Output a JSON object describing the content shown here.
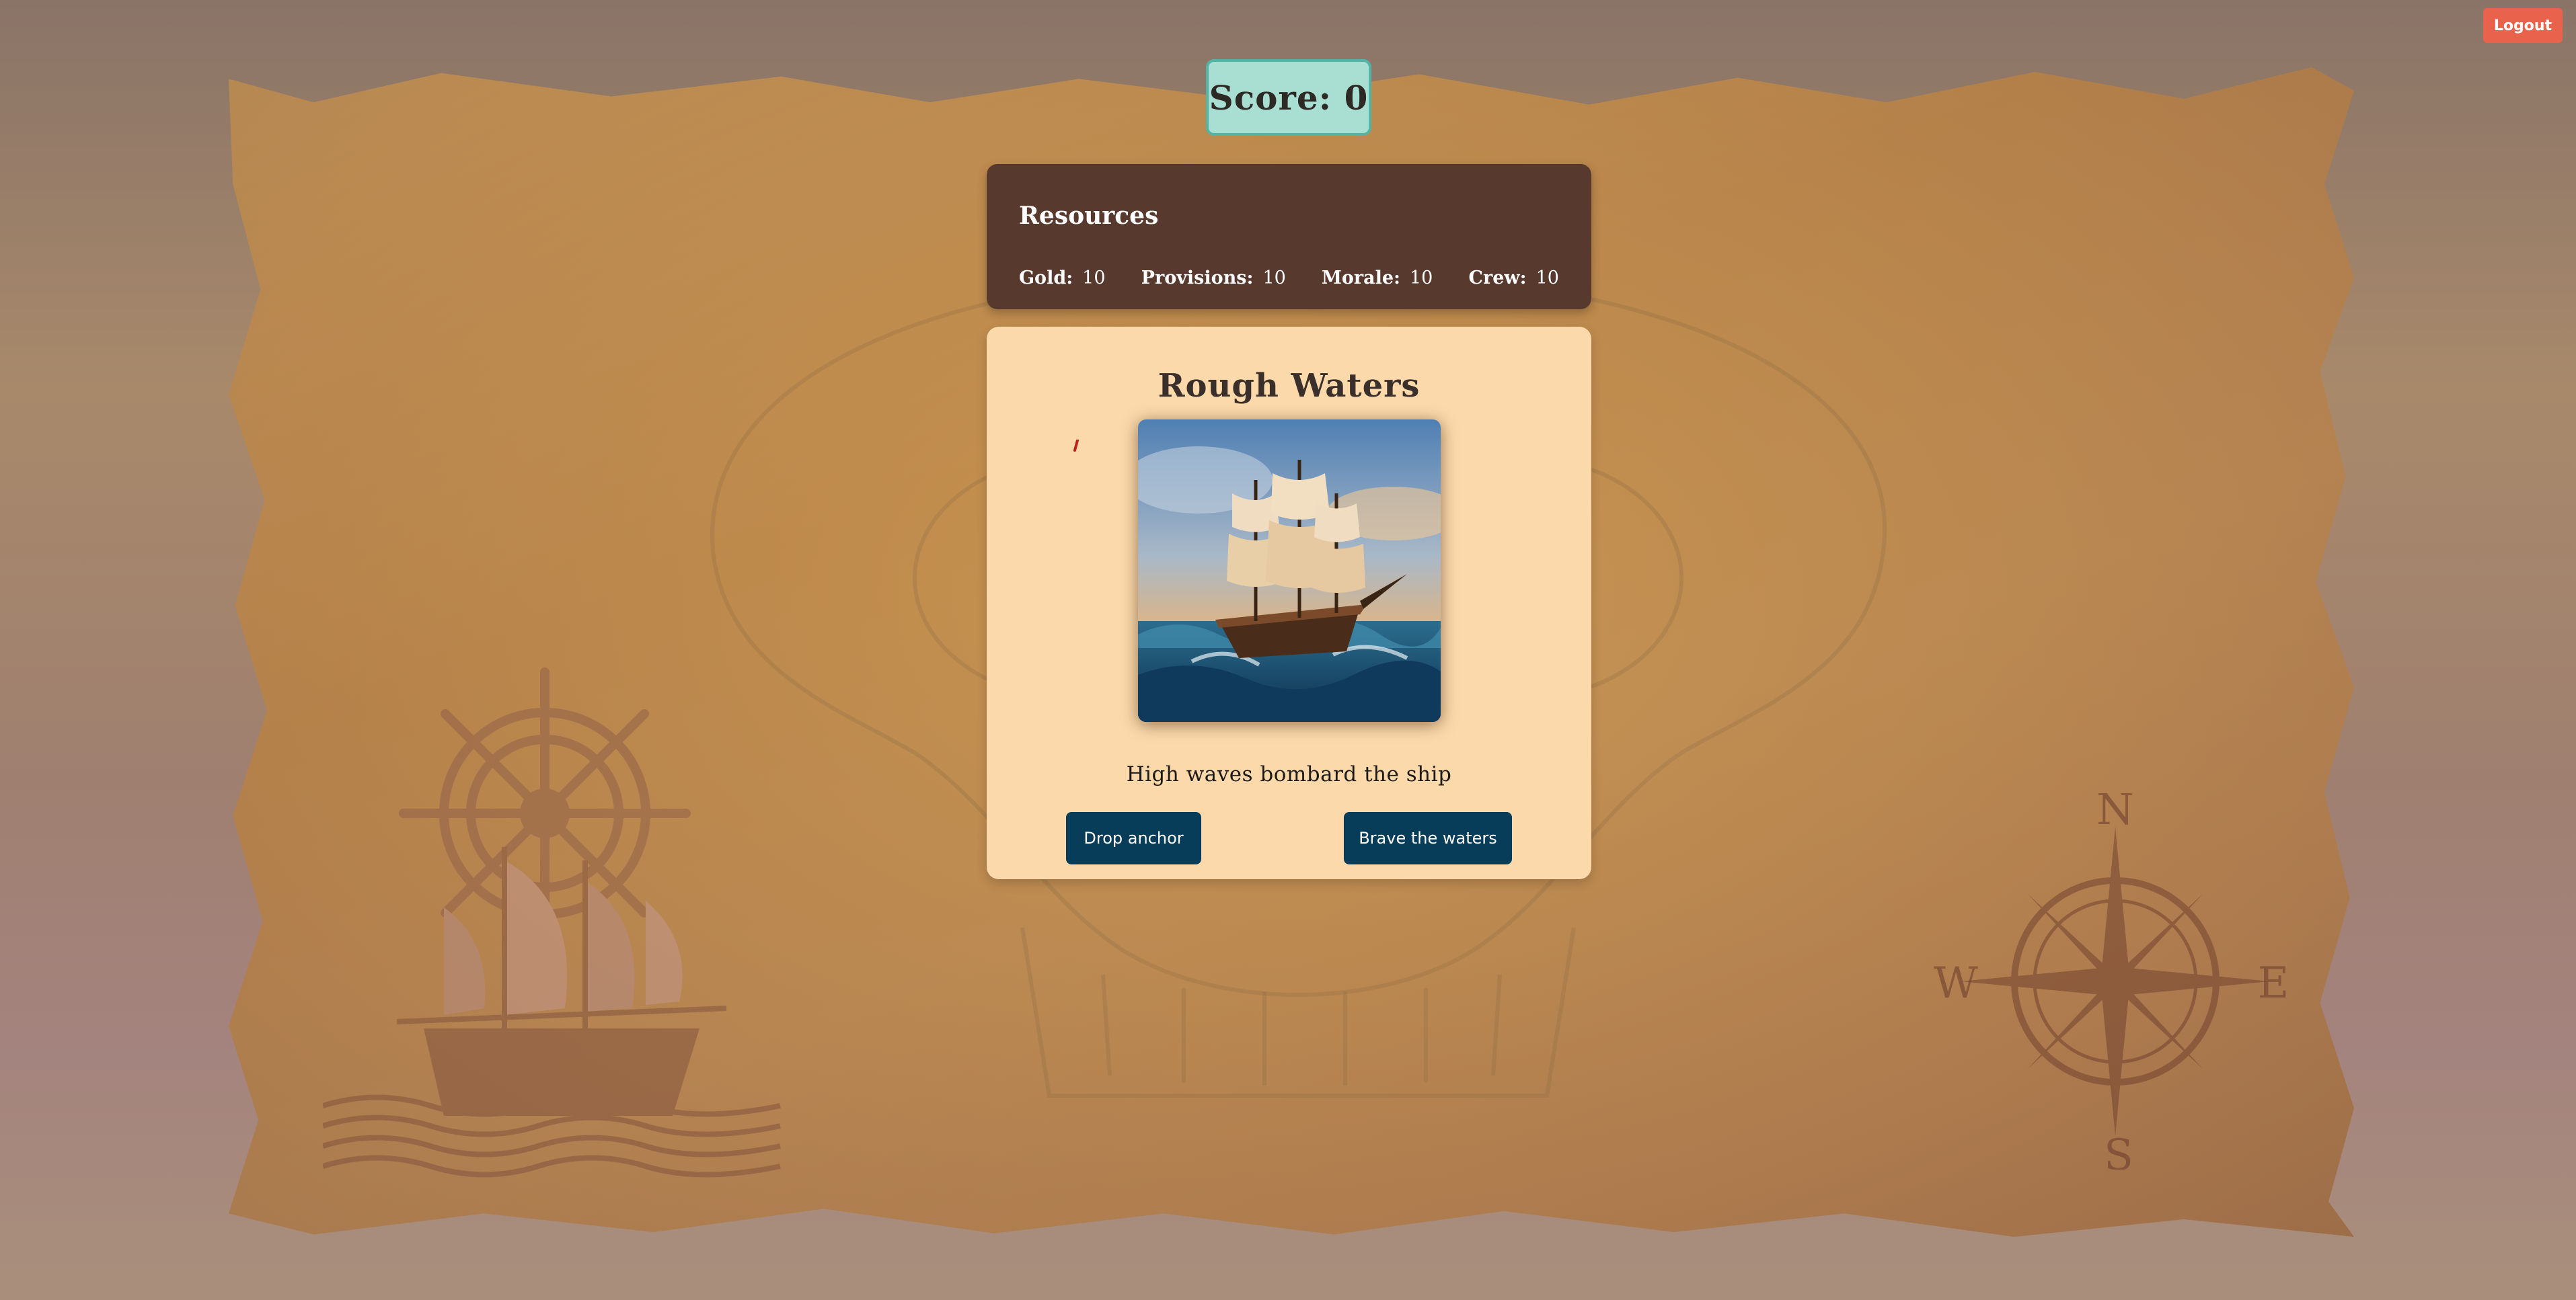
{
  "header": {
    "logout_label": "Logout",
    "score_label": "Score:",
    "score_value": "0"
  },
  "resources": {
    "title": "Resources",
    "items": [
      {
        "label": "Gold:",
        "value": "10"
      },
      {
        "label": "Provisions:",
        "value": "10"
      },
      {
        "label": "Morale:",
        "value": "10"
      },
      {
        "label": "Crew:",
        "value": "10"
      }
    ]
  },
  "event": {
    "title": "Rough Waters",
    "description": "High waves bombard the ship",
    "choices": [
      {
        "label": "Drop anchor"
      },
      {
        "label": "Brave the waters"
      }
    ]
  },
  "decor": {
    "compass_labels": {
      "north": "N",
      "south": "S",
      "east": "E",
      "west": "W"
    }
  },
  "colors": {
    "logout": "#e8624c",
    "score_bg": "#a8dfd2",
    "resources_bg": "#58392e",
    "card_bg": "#fbd9ab",
    "button_bg": "#073d58"
  }
}
